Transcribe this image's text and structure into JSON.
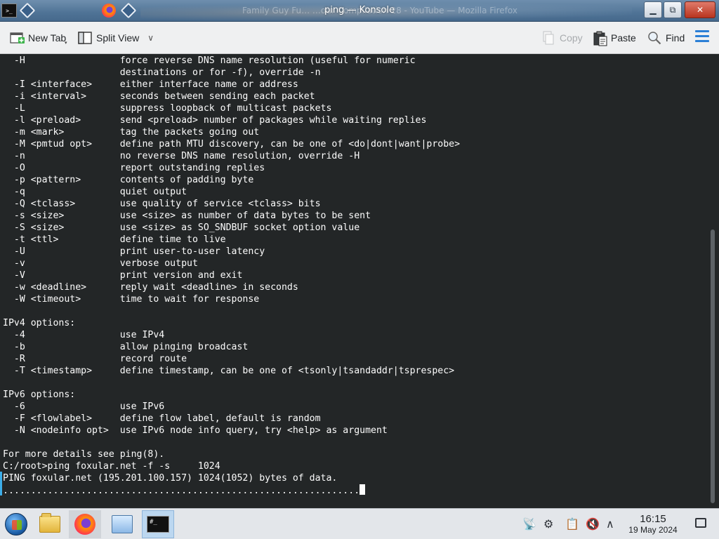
{
  "window": {
    "title": "ping — Konsole",
    "background_title": "Family Guy Fu… …our Compilation 28 - YouTube — Mozilla Firefox"
  },
  "toolbar": {
    "new_tab_label": "New Tab",
    "split_view_label": "Split View",
    "copy_label": "Copy",
    "paste_label": "Paste",
    "find_label": "Find"
  },
  "terminal": {
    "lines": [
      "  -H                 force reverse DNS name resolution (useful for numeric",
      "                     destinations or for -f), override -n",
      "  -I <interface>     either interface name or address",
      "  -i <interval>      seconds between sending each packet",
      "  -L                 suppress loopback of multicast packets",
      "  -l <preload>       send <preload> number of packages while waiting replies",
      "  -m <mark>          tag the packets going out",
      "  -M <pmtud opt>     define path MTU discovery, can be one of <do|dont|want|probe>",
      "  -n                 no reverse DNS name resolution, override -H",
      "  -O                 report outstanding replies",
      "  -p <pattern>       contents of padding byte",
      "  -q                 quiet output",
      "  -Q <tclass>        use quality of service <tclass> bits",
      "  -s <size>          use <size> as number of data bytes to be sent",
      "  -S <size>          use <size> as SO_SNDBUF socket option value",
      "  -t <ttl>           define time to live",
      "  -U                 print user-to-user latency",
      "  -v                 verbose output",
      "  -V                 print version and exit",
      "  -w <deadline>      reply wait <deadline> in seconds",
      "  -W <timeout>       time to wait for response",
      "",
      "IPv4 options:",
      "  -4                 use IPv4",
      "  -b                 allow pinging broadcast",
      "  -R                 record route",
      "  -T <timestamp>     define timestamp, can be one of <tsonly|tsandaddr|tsprespec>",
      "",
      "IPv6 options:",
      "  -6                 use IPv6",
      "  -F <flowlabel>     define flow label, default is random",
      "  -N <nodeinfo opt>  use IPv6 node info query, try <help> as argument",
      "",
      "For more details see ping(8).",
      "C:/root>ping foxular.net -f -s     1024",
      "PING foxular.net (195.201.100.157) 1024(1052) bytes of data.",
      "................................................................"
    ]
  },
  "taskbar": {
    "items": [
      "start-menu",
      "file-manager",
      "firefox",
      "system-settings",
      "konsole"
    ],
    "clock_time": "16:15",
    "clock_date": "19 May 2024"
  },
  "icons": {
    "titlebar": [
      "terminal-icon",
      "diamond-icon",
      "firefox-icon",
      "diamond-icon"
    ],
    "tray": [
      "network-icon",
      "updates-icon",
      "clipboard-icon",
      "volume-muted-icon",
      "expand-tray-icon"
    ]
  },
  "colors": {
    "terminal_bg": "#232627",
    "terminal_fg": "#fcfcfc",
    "accent": "#2b7fd6"
  }
}
